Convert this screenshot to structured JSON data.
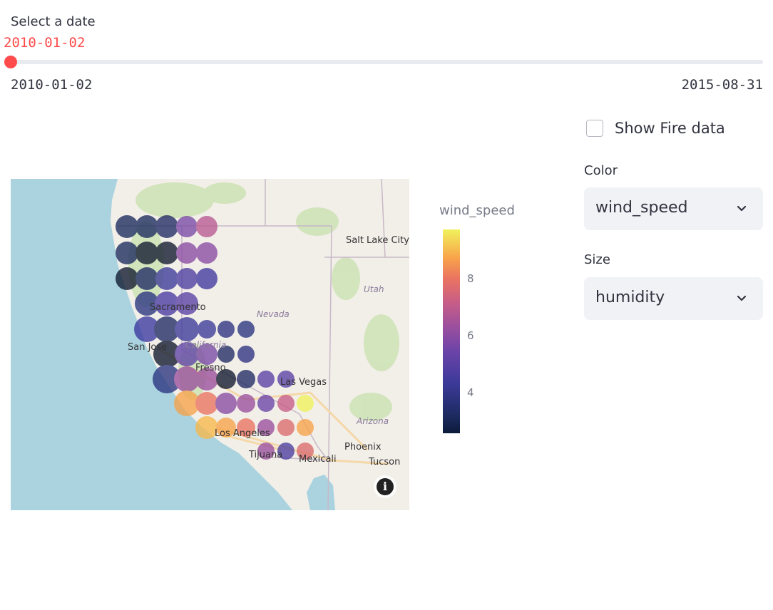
{
  "slider": {
    "label": "Select a date",
    "value": "2010-01-02",
    "min_label": "2010-01-02",
    "max_label": "2015-08-31",
    "position_fraction": 0.0
  },
  "map": {
    "places": [
      "Salt Lake City",
      "Utah",
      "Nevada",
      "Sacramento",
      "San Jose",
      "California",
      "Fresno",
      "Las Vegas",
      "Los Angeles",
      "Arizona",
      "Phoenix",
      "Tijuana",
      "Mexicali",
      "Tucson"
    ],
    "info_icon": "info-icon"
  },
  "legend": {
    "title": "wind_speed",
    "ticks": [
      "8",
      "6",
      "4"
    ],
    "colorscale": "plasma"
  },
  "controls": {
    "checkbox_label": "Show Fire data",
    "checkbox_checked": false,
    "color_label": "Color",
    "color_value": "wind_speed",
    "size_label": "Size",
    "size_value": "humidity"
  },
  "colors": {
    "accent": "#ff4b4b",
    "select_bg": "#f0f2f6",
    "water": "#aad3df",
    "land": "#f2efe9"
  }
}
